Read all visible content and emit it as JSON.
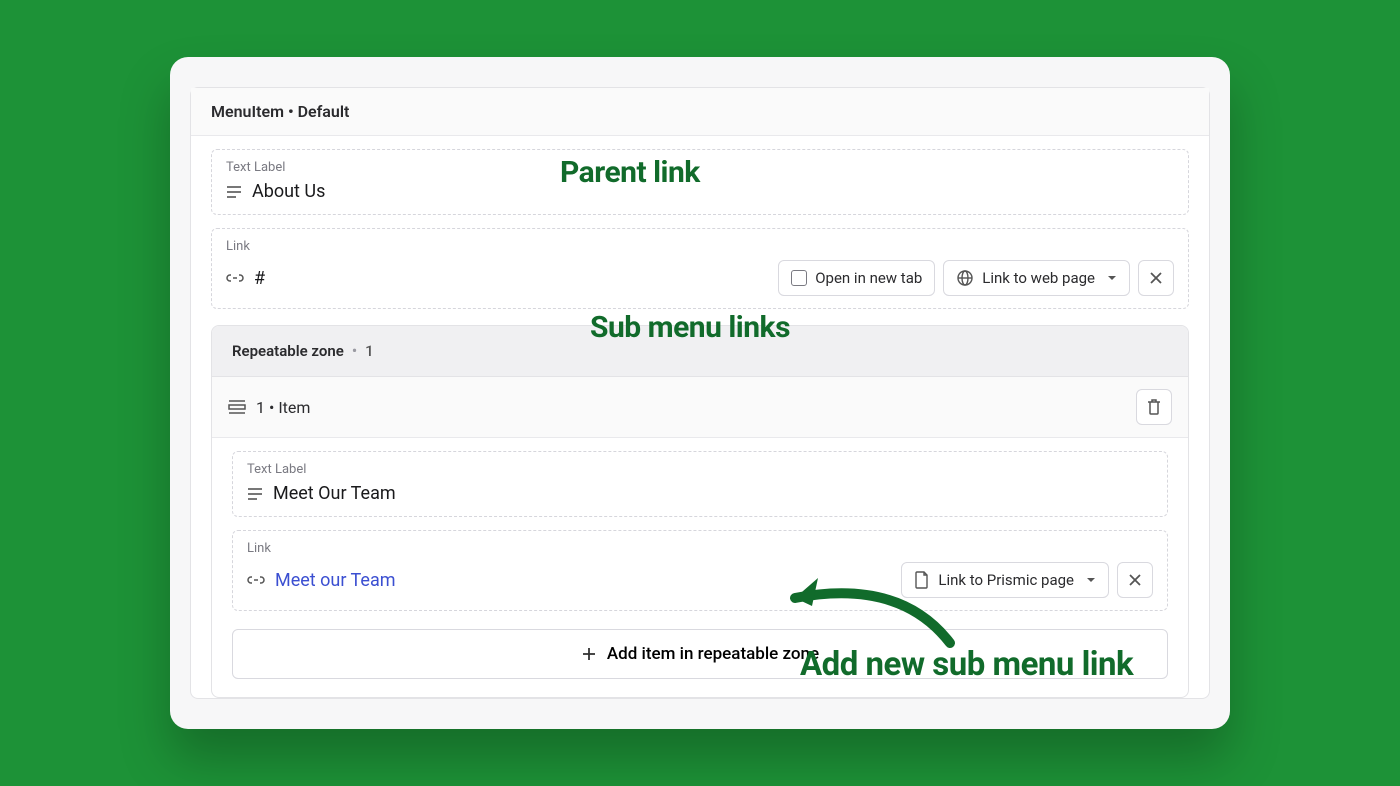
{
  "panel": {
    "header": "MenuItem • Default",
    "textLabel_label": "Text Label",
    "textLabel_value": "About Us",
    "link_label": "Link",
    "link_value": "#",
    "openNewTab": "Open in new tab",
    "linkType": "Link to web page"
  },
  "zone": {
    "name": "Repeatable zone",
    "count": "1",
    "itemLabel": "1 • Item",
    "item": {
      "textLabel_label": "Text Label",
      "textLabel_value": "Meet Our Team",
      "link_label": "Link",
      "link_value": "Meet our Team",
      "linkType": "Link to Prismic page"
    }
  },
  "addButton": "Add item in repeatable zone",
  "annotations": {
    "parent": "Parent link",
    "submenu": "Sub menu links",
    "addNew": "Add new sub menu link"
  }
}
